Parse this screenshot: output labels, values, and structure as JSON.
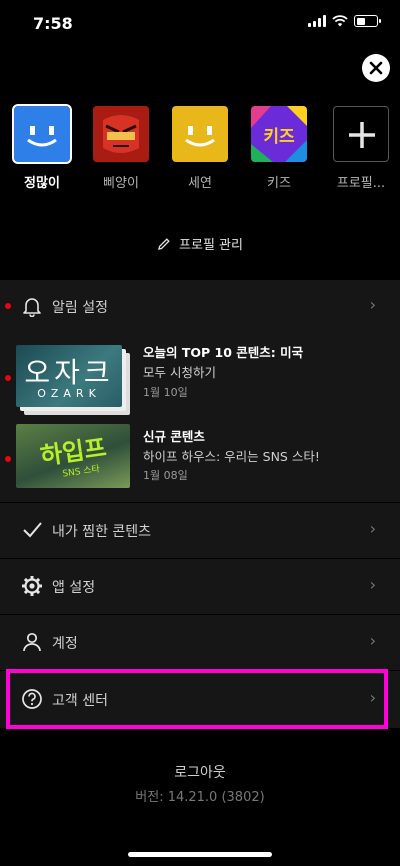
{
  "status": {
    "time": "7:58"
  },
  "profiles": [
    {
      "name": "정많이",
      "color": "#2e7fe8",
      "active": true
    },
    {
      "name": "삐양이",
      "color": "#c8291f",
      "active": false
    },
    {
      "name": "세연",
      "color": "#e8b81b",
      "active": false
    },
    {
      "name": "키즈",
      "color": "#2a8f3c",
      "active": false,
      "badge": "키즈"
    },
    {
      "name": "프로필...",
      "color": "#000000",
      "active": false
    }
  ],
  "manage_profiles": "프로필 관리",
  "menu": {
    "notifications": "알림 설정",
    "my_list": "내가 찜한 콘텐츠",
    "app_settings": "앱 설정",
    "account": "계정",
    "help": "고객 센터"
  },
  "notifications": [
    {
      "title": "오늘의 TOP 10 콘텐츠: 미국",
      "subtitle": "모두 시청하기",
      "date": "1월 10일",
      "thumb_text": "오자크",
      "thumb_sub": "OZARK"
    },
    {
      "title": "신규 콘텐츠",
      "subtitle": "하이프 하우스: 우리는 SNS 스타!",
      "date": "1월 08일",
      "thumb_text": "하입프",
      "thumb_sub": "SNS 스타"
    }
  ],
  "logout": "로그아웃",
  "version": "버전: 14.21.0 (3802)",
  "colors": {
    "accent_red": "#e50914",
    "highlight": "#ff00d8"
  }
}
